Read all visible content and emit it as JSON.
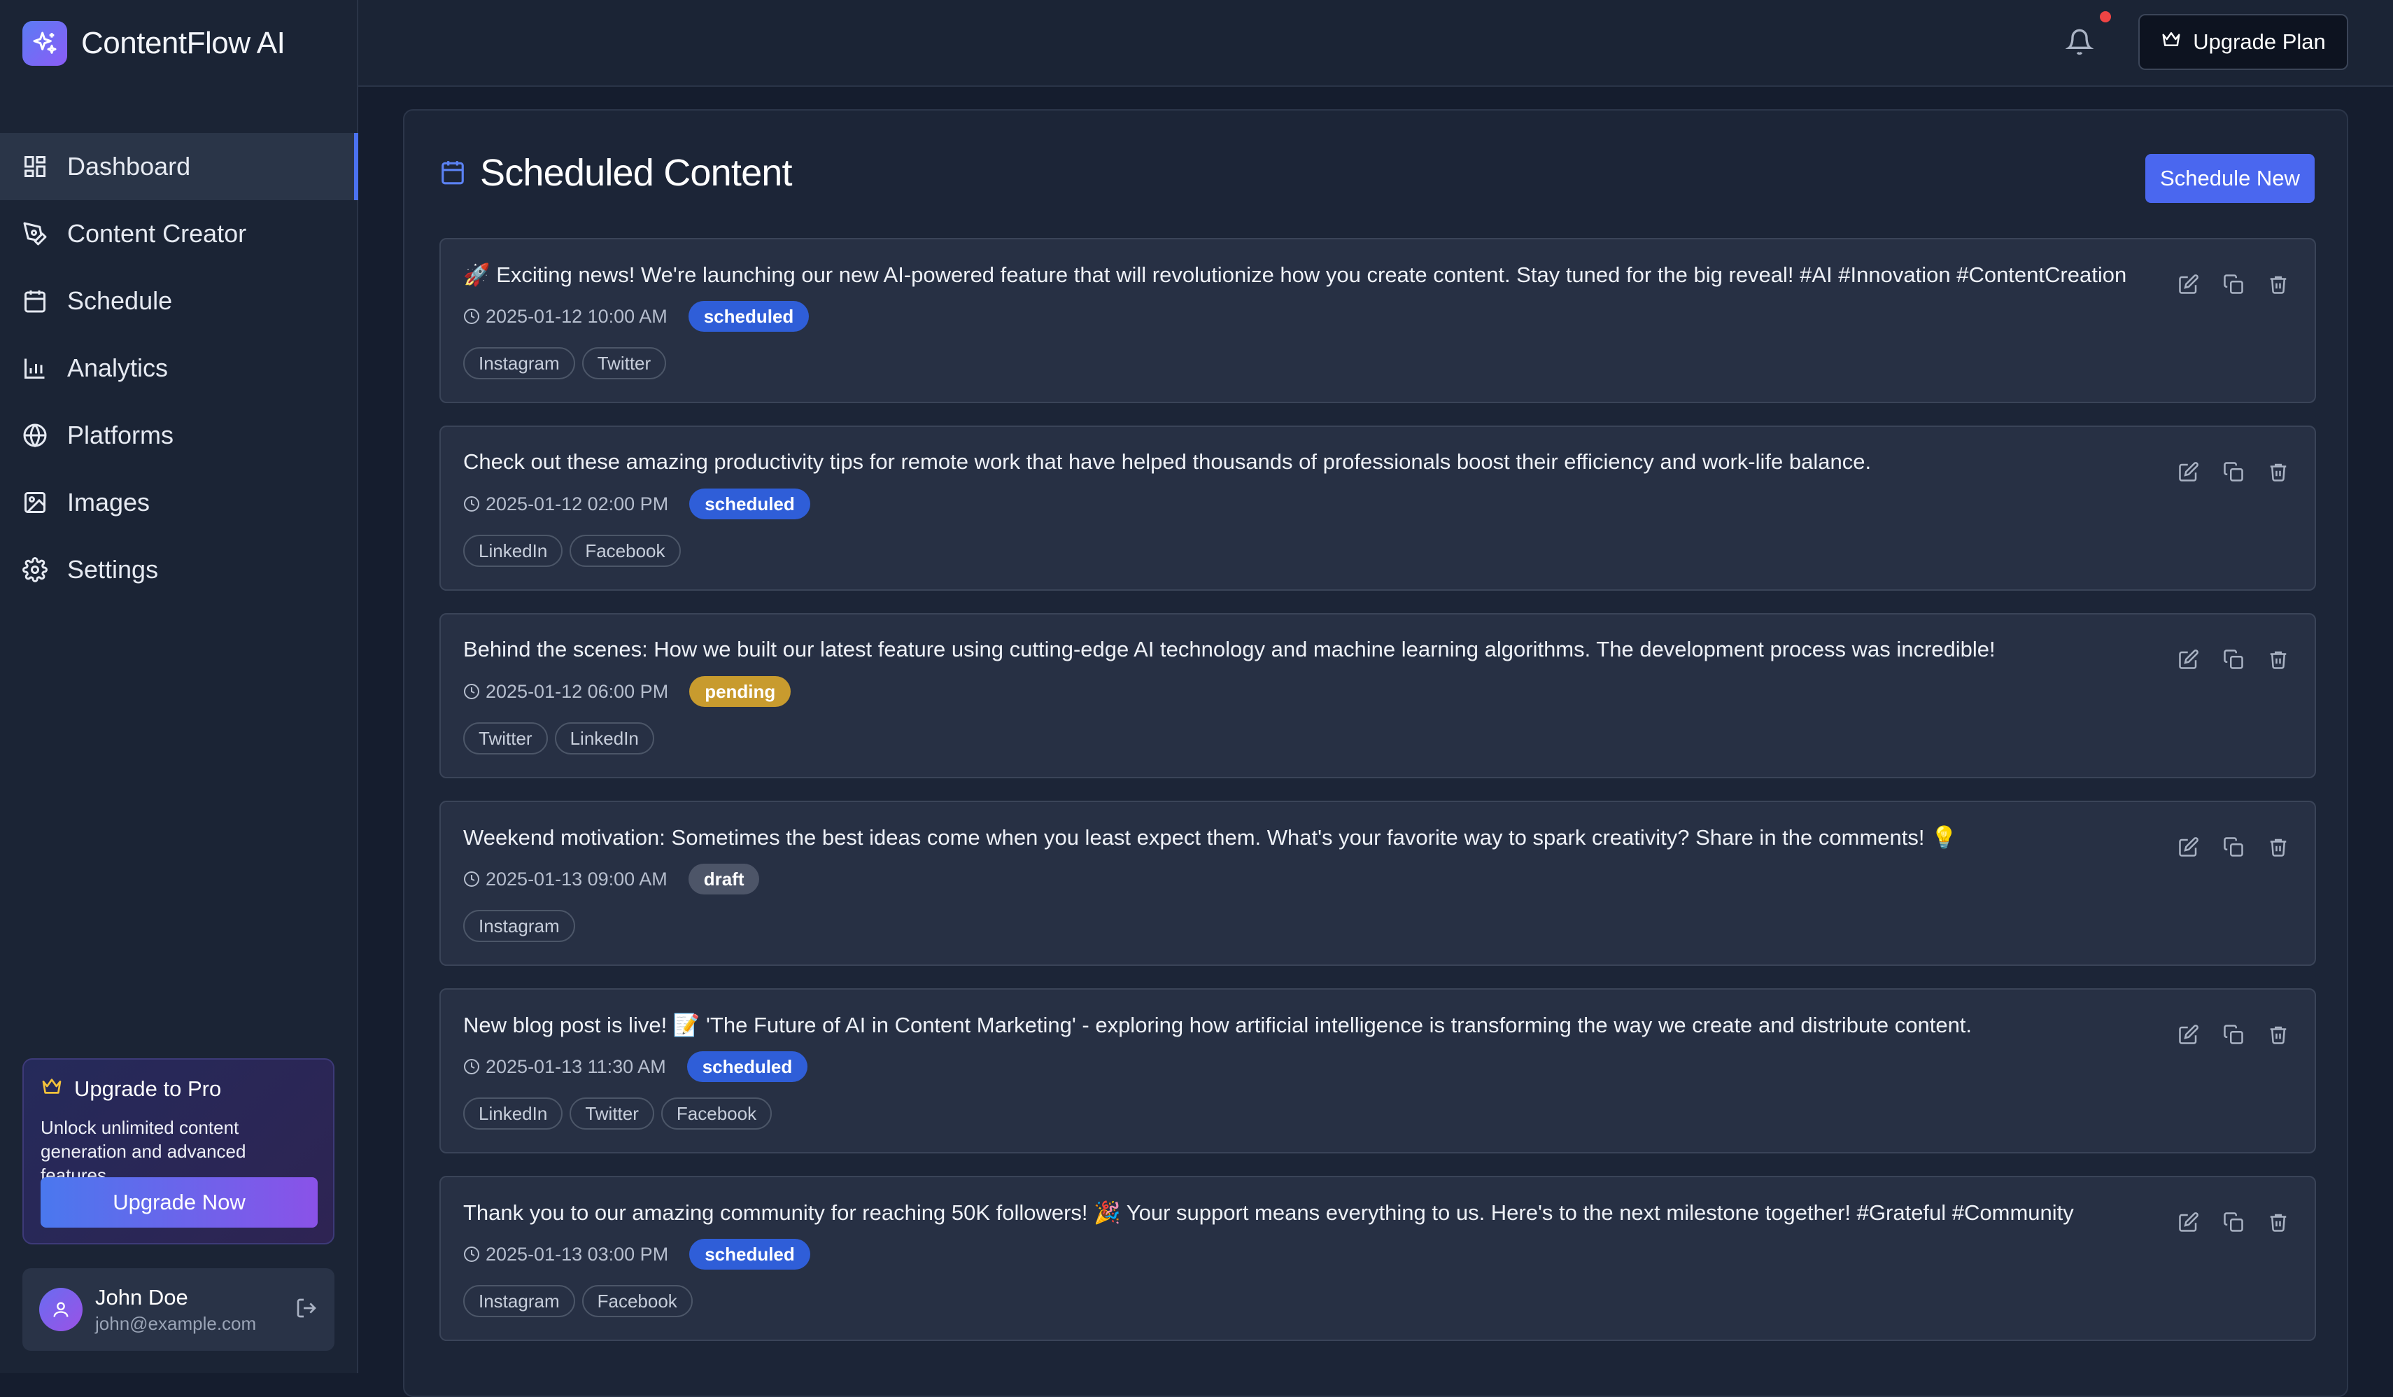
{
  "brand": {
    "name": "ContentFlow AI"
  },
  "colors": {
    "accent": "#4a67ef",
    "scheduled": "#2f5ed8",
    "pending": "#c89b2e",
    "draft": "#4d5568",
    "notification_dot": "#ef4444"
  },
  "sidebar": {
    "items": [
      {
        "label": "Dashboard",
        "icon": "dashboard-icon",
        "active": true
      },
      {
        "label": "Content Creator",
        "icon": "pen-icon"
      },
      {
        "label": "Schedule",
        "icon": "calendar-icon"
      },
      {
        "label": "Analytics",
        "icon": "bar-chart-icon"
      },
      {
        "label": "Platforms",
        "icon": "globe-icon"
      },
      {
        "label": "Images",
        "icon": "image-icon"
      },
      {
        "label": "Settings",
        "icon": "gear-icon"
      }
    ],
    "promo": {
      "title": "Upgrade to Pro",
      "text": "Unlock unlimited content generation and advanced features",
      "button": "Upgrade Now"
    },
    "user": {
      "name": "John Doe",
      "email": "john@example.com"
    }
  },
  "topbar": {
    "upgrade_label": "Upgrade Plan"
  },
  "main": {
    "title": "Scheduled Content",
    "schedule_new": "Schedule New",
    "posts": [
      {
        "text": "🚀 Exciting news! We're launching our new AI-powered feature that will revolutionize how you create content. Stay tuned for the big reveal! #AI #Innovation #ContentCreation",
        "time": "2025-01-12 10:00 AM",
        "status": "scheduled",
        "platforms": [
          "Instagram",
          "Twitter"
        ]
      },
      {
        "text": "Check out these amazing productivity tips for remote work that have helped thousands of professionals boost their efficiency and work-life balance.",
        "time": "2025-01-12 02:00 PM",
        "status": "scheduled",
        "platforms": [
          "LinkedIn",
          "Facebook"
        ]
      },
      {
        "text": "Behind the scenes: How we built our latest feature using cutting-edge AI technology and machine learning algorithms. The development process was incredible!",
        "time": "2025-01-12 06:00 PM",
        "status": "pending",
        "platforms": [
          "Twitter",
          "LinkedIn"
        ]
      },
      {
        "text": "Weekend motivation: Sometimes the best ideas come when you least expect them. What's your favorite way to spark creativity? Share in the comments! 💡",
        "time": "2025-01-13 09:00 AM",
        "status": "draft",
        "platforms": [
          "Instagram"
        ]
      },
      {
        "text": "New blog post is live! 📝 'The Future of AI in Content Marketing' - exploring how artificial intelligence is transforming the way we create and distribute content.",
        "time": "2025-01-13 11:30 AM",
        "status": "scheduled",
        "platforms": [
          "LinkedIn",
          "Twitter",
          "Facebook"
        ]
      },
      {
        "text": "Thank you to our amazing community for reaching 50K followers! 🎉 Your support means everything to us. Here's to the next milestone together! #Grateful #Community",
        "time": "2025-01-13 03:00 PM",
        "status": "scheduled",
        "platforms": [
          "Instagram",
          "Facebook"
        ]
      }
    ]
  }
}
